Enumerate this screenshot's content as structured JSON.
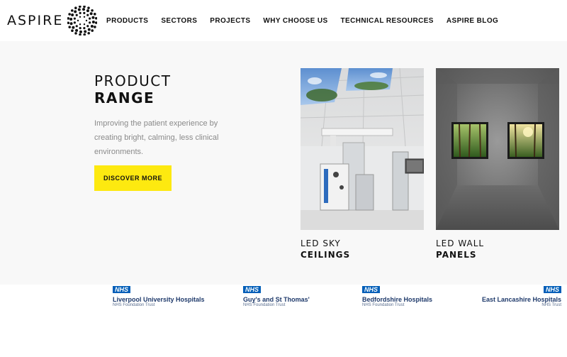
{
  "brand": {
    "name": "ASPIRE"
  },
  "nav": {
    "items": [
      {
        "label": "PRODUCTS",
        "active": true
      },
      {
        "label": "SECTORS",
        "active": false
      },
      {
        "label": "PROJECTS",
        "active": false
      },
      {
        "label": "WHY CHOOSE US",
        "active": false
      },
      {
        "label": "TECHNICAL RESOURCES",
        "active": true
      },
      {
        "label": "ASPIRE BLOG",
        "active": false
      }
    ]
  },
  "menu": {
    "title_light": "PRODUCT",
    "title_bold": "RANGE",
    "description": "Improving the patient experience by creating bright, calming, less clinical environments.",
    "cta_label": "DISCOVER MORE",
    "cta_color": "#fde910",
    "cards": [
      {
        "label_light": "LED SKY",
        "label_bold": "CEILINGS"
      },
      {
        "label_light": "LED WALL",
        "label_bold": "PANELS"
      }
    ]
  },
  "trusts": [
    {
      "badge": "NHS",
      "name": "Liverpool University Hospitals",
      "sub": "NHS Foundation Trust"
    },
    {
      "badge": "NHS",
      "name": "Guy's and St Thomas'",
      "sub": "NHS Foundation Trust"
    },
    {
      "badge": "NHS",
      "name": "Bedfordshire Hospitals",
      "sub": "NHS Foundation Trust"
    },
    {
      "badge": "NHS",
      "name": "East Lancashire Hospitals",
      "sub": "NHS Trust"
    }
  ],
  "colors": {
    "accent": "#fde910",
    "nhs_blue": "#005eb8",
    "panel_bg": "#f8f8f8"
  }
}
